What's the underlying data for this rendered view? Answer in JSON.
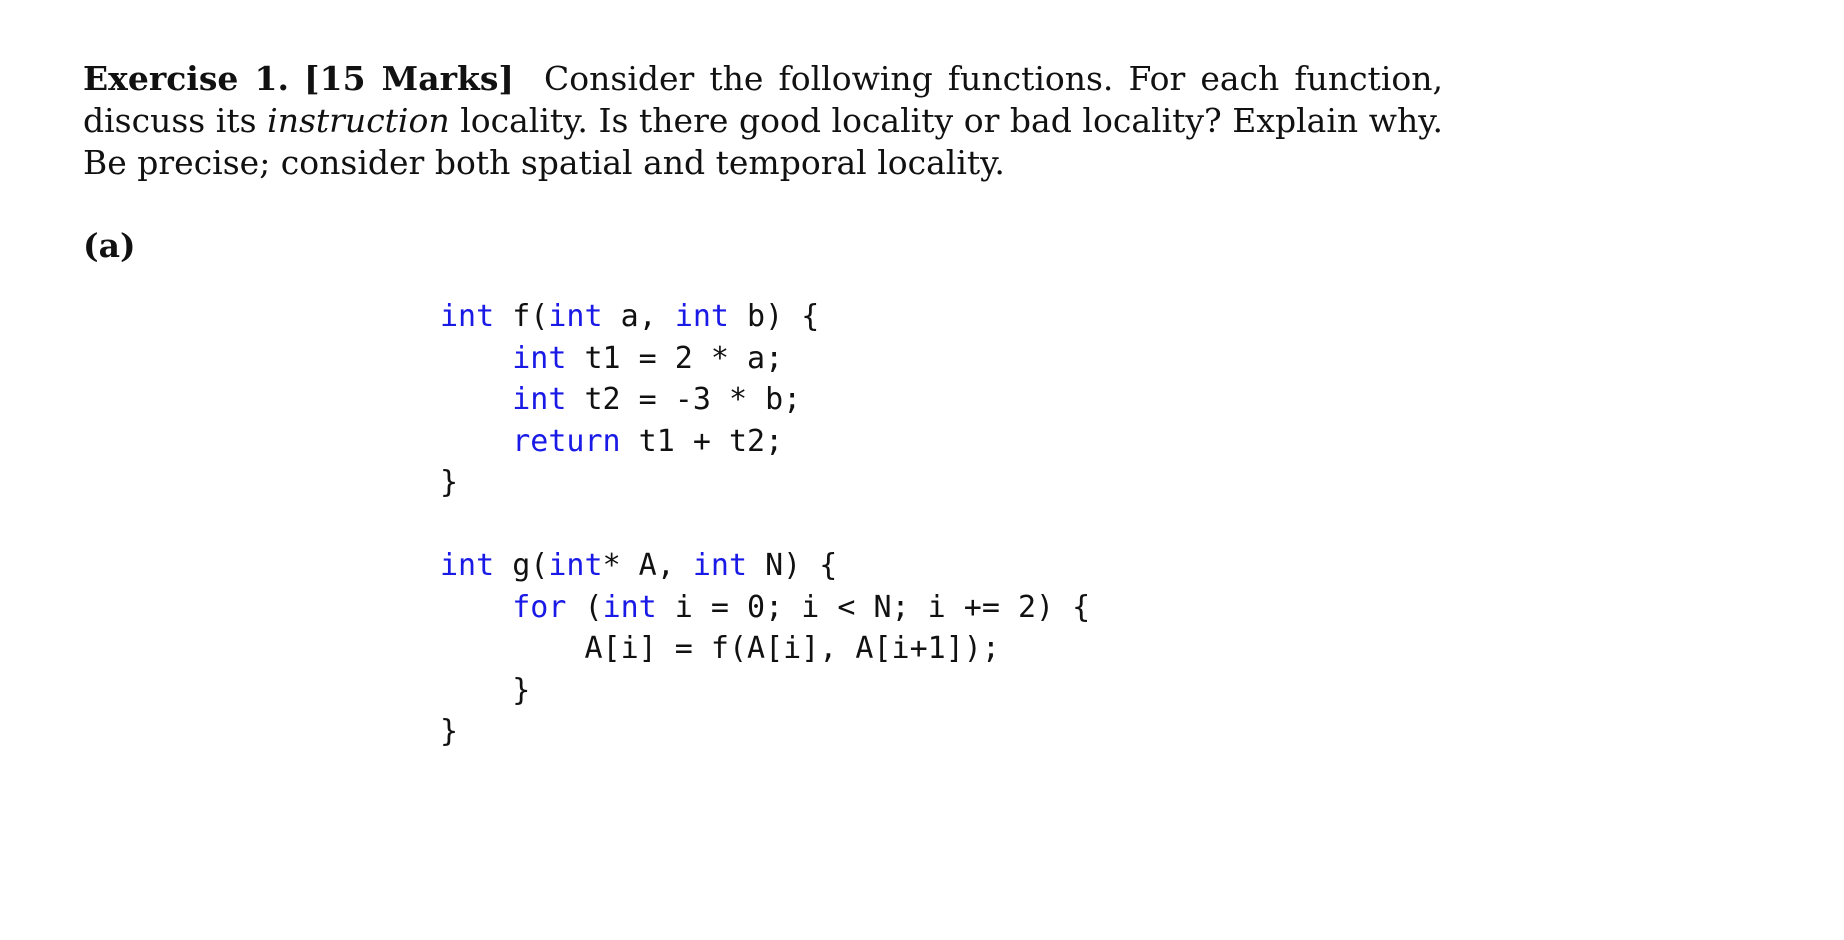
{
  "exercise": {
    "label": "Exercise 1.",
    "marks": "[15 Marks]",
    "text_1": "Consider the following functions. For each function, discuss its",
    "emph": "instruction",
    "text_2": " locality. Is there good locality or bad locality? Explain why. Be precise; consider both spatial and temporal locality."
  },
  "part": {
    "label": "(a)"
  },
  "code_f": {
    "lines": [
      [
        {
          "t": "int",
          "k": true
        },
        {
          "t": " f("
        },
        {
          "t": "int",
          "k": true
        },
        {
          "t": " a, "
        },
        {
          "t": "int",
          "k": true
        },
        {
          "t": " b) {"
        }
      ],
      [
        {
          "t": "    "
        },
        {
          "t": "int",
          "k": true
        },
        {
          "t": " t1 = 2 * a;"
        }
      ],
      [
        {
          "t": "    "
        },
        {
          "t": "int",
          "k": true
        },
        {
          "t": " t2 = -3 * b;"
        }
      ],
      [
        {
          "t": "    "
        },
        {
          "t": "return",
          "k": true
        },
        {
          "t": " t1 + t2;"
        }
      ],
      [
        {
          "t": "}"
        }
      ]
    ]
  },
  "code_g": {
    "lines": [
      [
        {
          "t": "int",
          "k": true
        },
        {
          "t": " g("
        },
        {
          "t": "int",
          "k": true
        },
        {
          "t": "* A, "
        },
        {
          "t": "int",
          "k": true
        },
        {
          "t": " N) {"
        }
      ],
      [
        {
          "t": "    "
        },
        {
          "t": "for",
          "k": true
        },
        {
          "t": " ("
        },
        {
          "t": "int",
          "k": true
        },
        {
          "t": " i = 0; i < N; i += 2) {"
        }
      ],
      [
        {
          "t": "        A[i] = f(A[i], A[i+1]);"
        }
      ],
      [
        {
          "t": "    }"
        }
      ],
      [
        {
          "t": "}"
        }
      ]
    ]
  },
  "colors": {
    "keyword": "#1a1ae6",
    "text": "#111111"
  }
}
